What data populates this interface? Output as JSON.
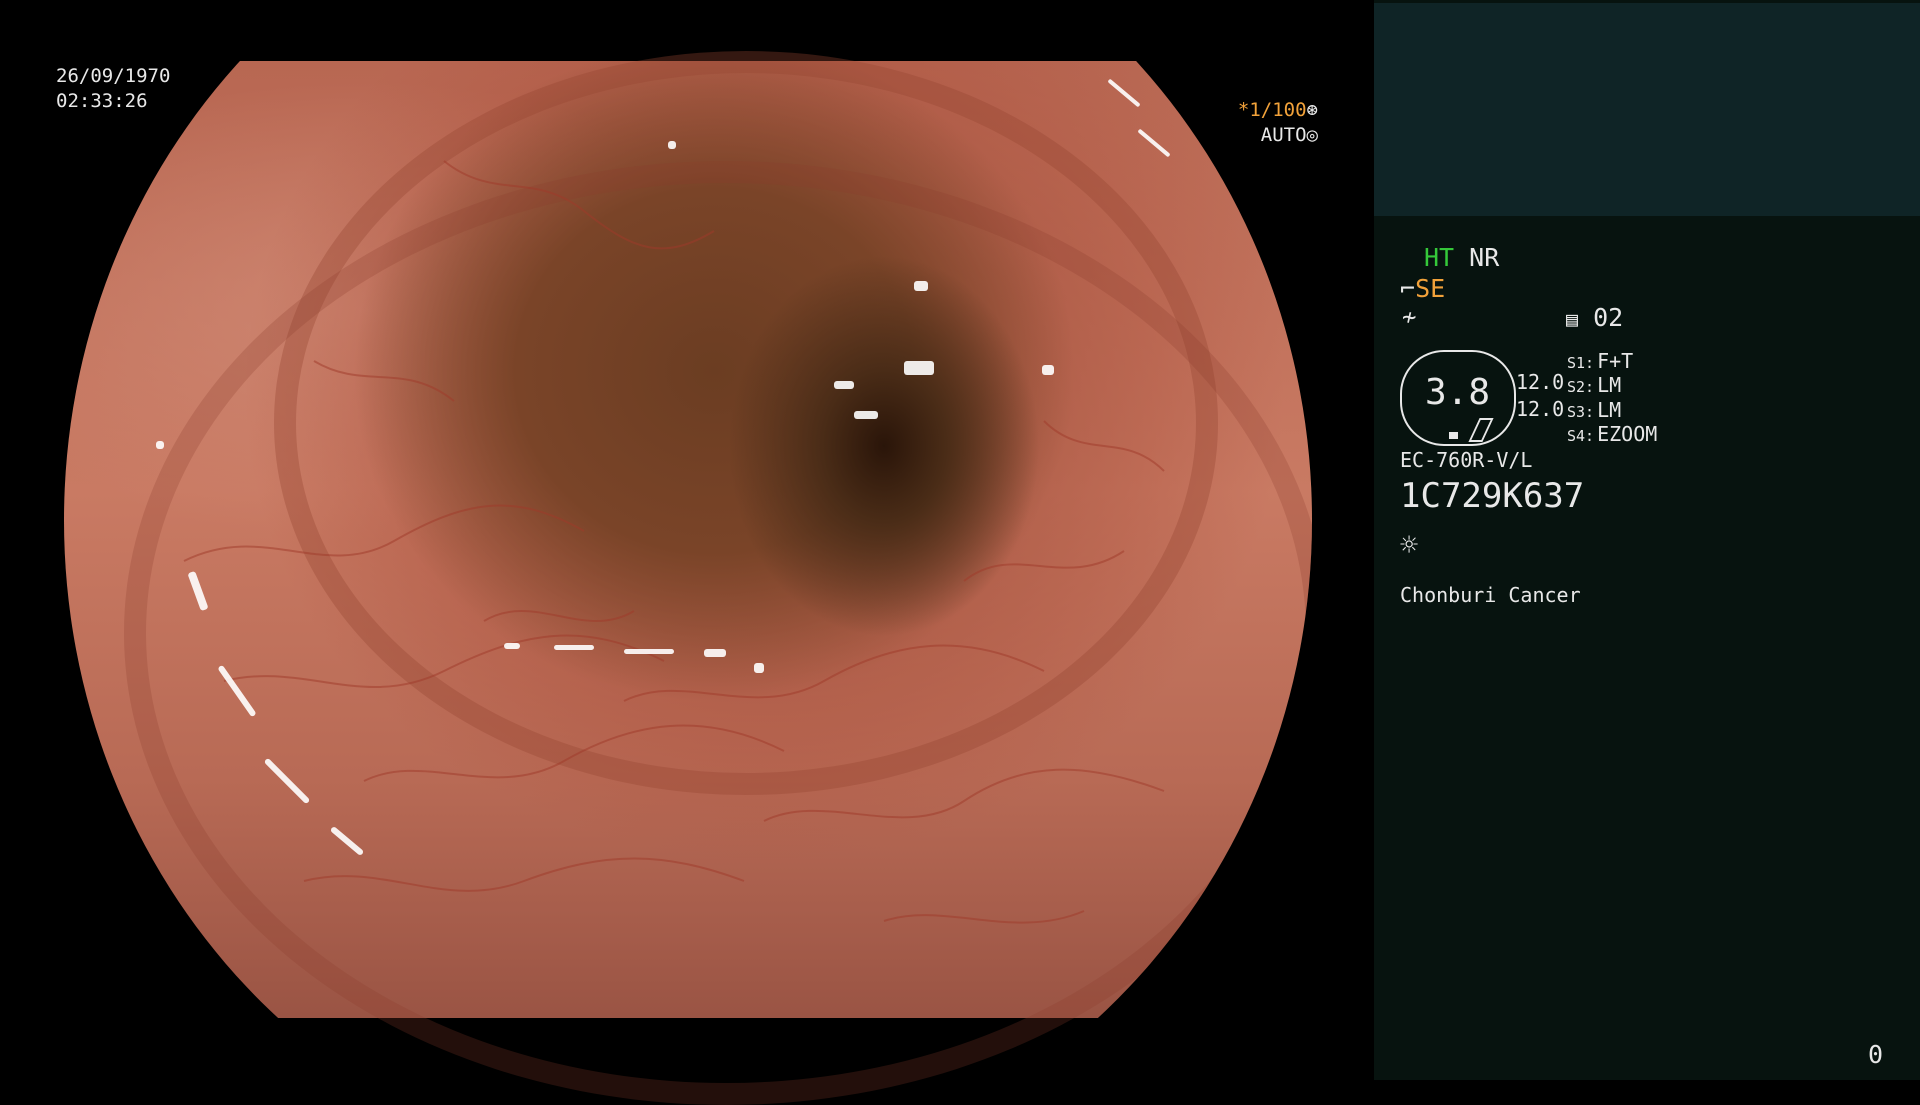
{
  "overlay": {
    "date": "26/09/1970",
    "time": "02:33:26",
    "shutter": "*1/100",
    "iris_mode": "AUTO"
  },
  "icons": {
    "shutter_icon": "aperture-icon",
    "iris_icon": "iris-icon",
    "mode_icon": "scope-mode-icon",
    "memory_icon": "memory-card-icon",
    "light_icon": "light-source-icon"
  },
  "panel": {
    "ht": "HT",
    "nr": "NR",
    "se": "SE",
    "channel": "02",
    "gauge_value": "3.8",
    "value_a": "12.0",
    "value_b": "12.0",
    "switches": [
      {
        "label": "S1:",
        "value": "F+T"
      },
      {
        "label": "S2:",
        "value": "LM"
      },
      {
        "label": "S3:",
        "value": "LM"
      },
      {
        "label": "S4:",
        "value": "EZOOM"
      }
    ],
    "scope_model": "EC-760R-V/L",
    "serial": "1C729K637",
    "site": "Chonburi Cancer",
    "counter": "0"
  },
  "colors": {
    "accent_green": "#35c83a",
    "accent_orange": "#f2a23a",
    "panel_bg": "#07130f",
    "panel_top_bg": "#0f2426"
  }
}
